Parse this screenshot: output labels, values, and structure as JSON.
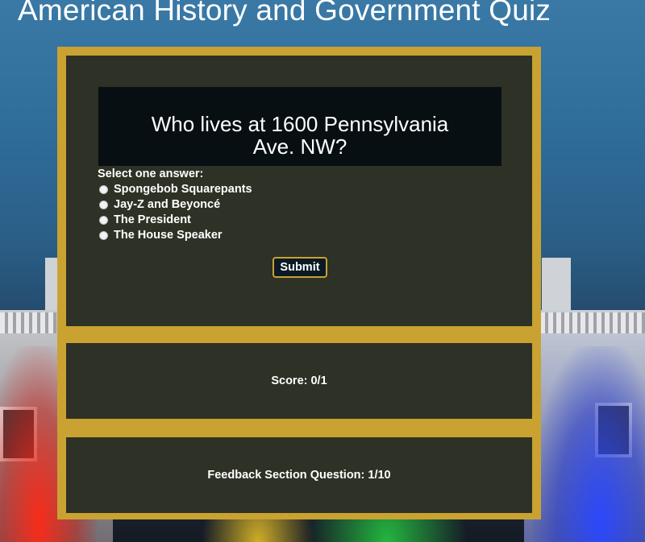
{
  "page": {
    "title": "American History and Government Quiz"
  },
  "question": {
    "text": "Who lives at 1600 Pennsylvania Ave. NW?",
    "prompt": "Select one answer:",
    "options": [
      "Spongebob Squarepants",
      "Jay-Z and Beyoncé",
      "The President",
      "The House Speaker"
    ],
    "submit_label": "Submit"
  },
  "score": {
    "text": "Score: 0/1"
  },
  "feedback": {
    "text": "Feedback Section Question: 1/10"
  },
  "colors": {
    "frame_gold": "#c9a232",
    "panel_dark": "#0c1822",
    "sky_blue": "#3a79a6"
  }
}
